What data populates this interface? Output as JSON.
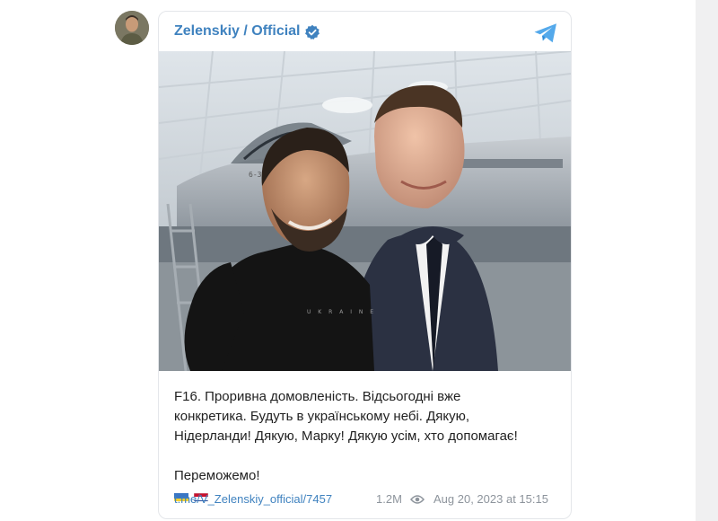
{
  "channel": {
    "name": "Zelenskiy / Official",
    "verified": true,
    "avatar_icon": "channel-avatar"
  },
  "post": {
    "lines": [
      "F16. Проривна домовленість. Відсьогодні вже",
      "конкретика. Будуть в українському небі. Дякую,",
      "Нідерланди! Дякую, Марку! Дякую усім, хто допомагає!"
    ],
    "closing": "Переможемо!",
    "flags": [
      "ukraine-flag",
      "netherlands-flag"
    ],
    "shirt_text": "U K R A I N E"
  },
  "footer": {
    "link": "t.me/V_Zelenskiy_official/7457",
    "views": "1.2M",
    "date": "Aug 20, 2023 at 15:15"
  },
  "colors": {
    "accent": "#3f82bf",
    "text": "#222222",
    "meta": "#8d949c",
    "border": "#e4e6ea"
  }
}
